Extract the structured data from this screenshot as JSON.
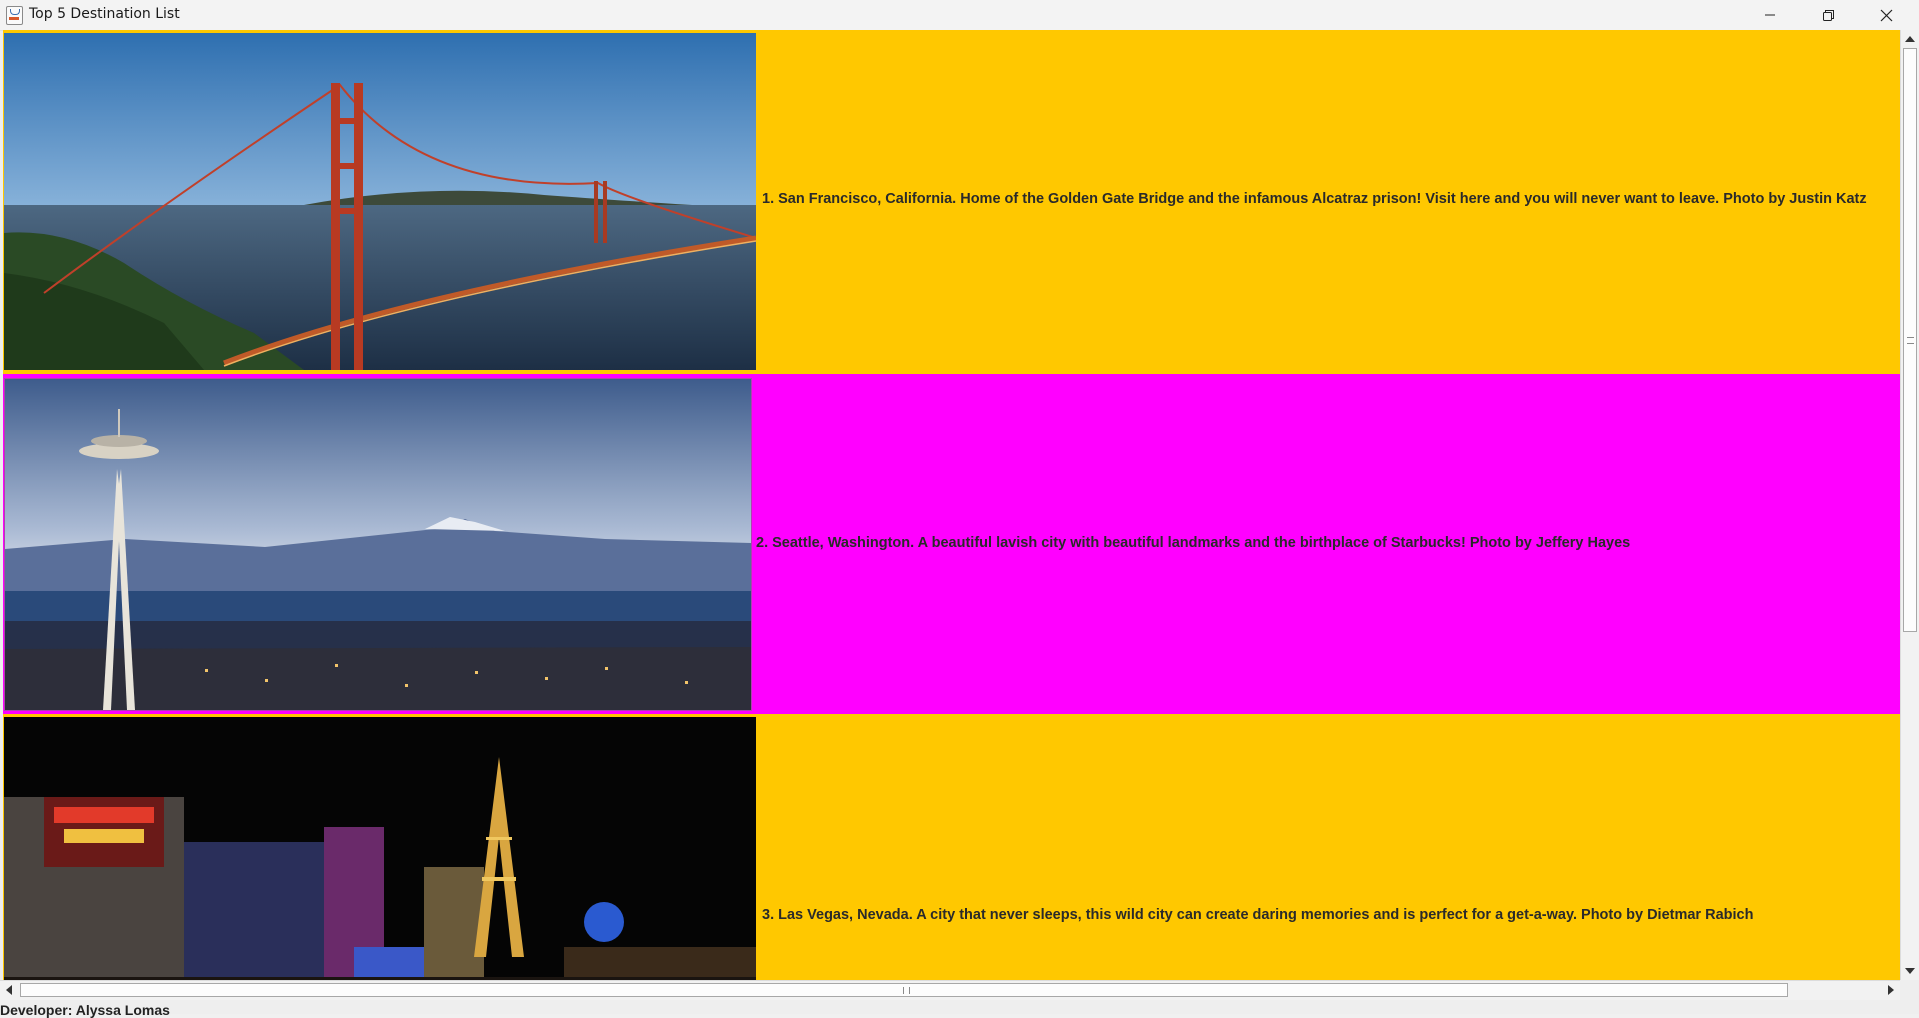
{
  "window": {
    "title": "Top 5 Destination List",
    "controls": {
      "minimize": "minimize-icon",
      "maximize": "restore-icon",
      "close": "close-icon"
    }
  },
  "destinations": [
    {
      "text": "1. San Francisco, California. Home of the Golden Gate Bridge and the infamous Alcatraz prison! Visit here and you will never want to leave. Photo by Justin Katz",
      "background": "#ffc800",
      "photo": "golden-gate-bridge-photo"
    },
    {
      "text": "2. Seattle, Washington. A beautiful lavish city with beautiful landmarks and the birthplace of Starbucks! Photo by Jeffery Hayes",
      "background": "#ff00ff",
      "photo": "space-needle-photo"
    },
    {
      "text": "3. Las Vegas, Nevada. A city that never sleeps, this wild city can create daring memories and is perfect for a get-a-way. Photo by Dietmar Rabich",
      "background": "#ffc800",
      "photo": "las-vegas-strip-photo"
    }
  ],
  "footer": {
    "text": "Developer: Alyssa Lomas"
  }
}
